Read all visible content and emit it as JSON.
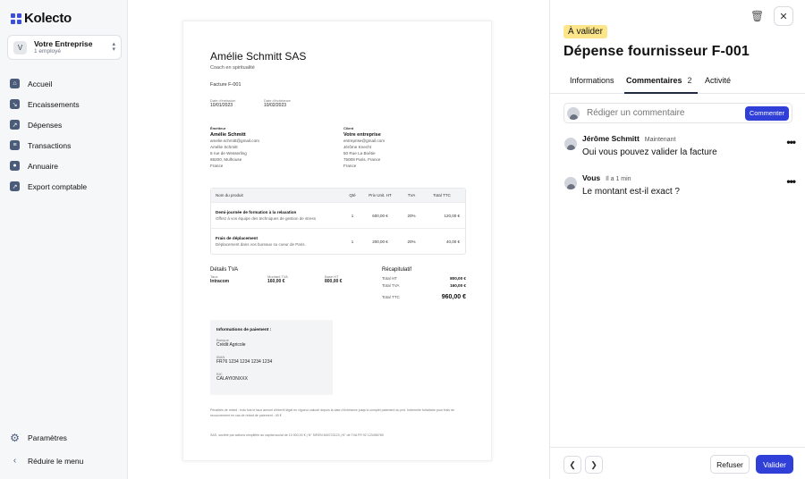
{
  "app": {
    "logo_text": "Kolecto"
  },
  "company": {
    "badge": "V",
    "name": "Votre Entreprise",
    "employees": "1 employé",
    "chevron": "⌃⌄"
  },
  "nav": {
    "items": [
      {
        "label": "Accueil",
        "icon": "home-icon",
        "glyph": "⌂"
      },
      {
        "label": "Encaissements",
        "icon": "arrow-in-icon",
        "glyph": "↘"
      },
      {
        "label": "Dépenses",
        "icon": "arrow-out-icon",
        "glyph": "↗"
      },
      {
        "label": "Transactions",
        "icon": "bank-icon",
        "glyph": "≡"
      },
      {
        "label": "Annuaire",
        "icon": "people-icon",
        "glyph": "●"
      },
      {
        "label": "Export comptable",
        "icon": "export-icon",
        "glyph": "↗"
      }
    ],
    "settings_label": "Paramètres",
    "collapse_label": "Réduire le menu"
  },
  "invoice": {
    "company_name": "Amélie Schmitt SAS",
    "company_subtitle": "Coach en spiritualité",
    "invoice_number": "Facture F-001",
    "issue_date_label": "Date d'émission",
    "issue_date": "10/01/2023",
    "due_date_label": "Date d'échéance",
    "due_date": "10/02/2023",
    "issuer": {
      "heading": "Émetteur",
      "name": "Amélie Schmitt",
      "lines": [
        "amelie.schmitt@gmail.com",
        "Amélie Schmitt",
        "8 rue de Wesserling",
        "68200, Mulhouse",
        "France"
      ]
    },
    "client": {
      "heading": "Client",
      "name": "Votre entreprise",
      "lines": [
        "entreprise@gmail.com",
        "Jérôme Knecht",
        "50 Rue La Boétie",
        "75008 Paris, France",
        "France"
      ]
    },
    "table": {
      "headers": [
        "Nom du produit",
        "Qté",
        "Prix Unit. HT",
        "TVA",
        "Total TTC"
      ],
      "rows": [
        {
          "name": "Demi-journée de formation à la relaxation",
          "desc": "Offrez à vos équipe des techniques de gestion de stress",
          "qty": "1",
          "unit": "600,00 €",
          "vat": "20%",
          "total": "120,00 €"
        },
        {
          "name": "Frais de déplacement",
          "desc": "Déplacement dans vos bureaux su coeur de Paris.",
          "qty": "1",
          "unit": "200,00 €",
          "vat": "20%",
          "total": "40,00 €"
        }
      ]
    },
    "vat_details": {
      "title": "Détails TVA",
      "headers": [
        "Taux",
        "Montant TVA",
        "Base HT"
      ],
      "values": [
        "Intracom",
        "160,00 €",
        "800,00 €"
      ]
    },
    "recap": {
      "title": "Récapitulatif",
      "rows": [
        {
          "label": "Total HT",
          "value": "800,00 €"
        },
        {
          "label": "Total TVA",
          "value": "160,00 €"
        }
      ],
      "ttc_label": "Total TTC",
      "ttc_value": "960,00 €"
    },
    "payment": {
      "title": "Informations de paiement :",
      "bank_label": "Banque",
      "bank": "Crédit Agricole",
      "iban_label": "IBAN",
      "iban": "FR76 1234 1234 1234 1234",
      "bic_label": "BIC",
      "bic": "CALAYIONXXX"
    },
    "penalties": "Pénalités de retard : trois fois le taux annuel d'intérêt légal en vigueur calculé depuis la date d'échéance jusqu'à complet paiement du prix. Indemnité forfaitaire pour frais de recouvrement en cas de retard de paiement : 40 €",
    "legal": "SAS, société par actions simplifiée au capital social de 10 000,00 € | N° SIREN 845723123 | N° de TVA FR 92 123456789"
  },
  "panel": {
    "status": "À valider",
    "title": "Dépense fournisseur F-001",
    "tabs": [
      {
        "label": "Informations"
      },
      {
        "label": "Commentaires",
        "count": "2"
      },
      {
        "label": "Activité"
      }
    ],
    "comment_placeholder": "Rédiger un commentaire",
    "comment_button": "Commenter",
    "comments": [
      {
        "author": "Jérôme Schmitt",
        "meta": "Maintenant",
        "text": "Oui vous pouvez valider la facture"
      },
      {
        "author": "Vous",
        "meta": "Il  a 1 min",
        "text": "Le montant est-il exact ?"
      }
    ],
    "refuse_label": "Refuser",
    "validate_label": "Valider"
  },
  "colors": {
    "accent": "#2f3fd8",
    "status_badge": "#fde68a"
  }
}
